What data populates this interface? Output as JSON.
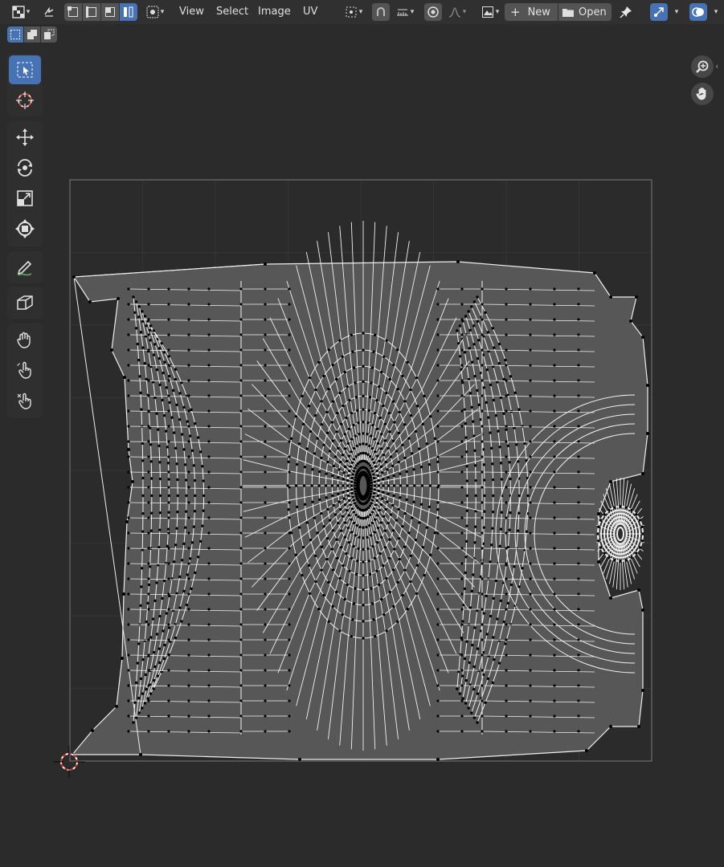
{
  "header": {
    "menus": [
      {
        "id": "view",
        "label": "View"
      },
      {
        "id": "select",
        "label": "Select"
      },
      {
        "id": "image",
        "label": "Image"
      },
      {
        "id": "uv",
        "label": "UV"
      }
    ],
    "new_label": "New",
    "open_label": "Open"
  },
  "icons": {
    "editor_type": "uv-editor-icon",
    "sync_selection": "sync-selection-icon",
    "select_modes": [
      "vertex-select-icon",
      "edge-select-icon",
      "face-select-icon",
      "island-select-icon"
    ],
    "sticky_mode": "sticky-selection-icon",
    "pivot": "pivot-point-icon",
    "snap": "snap-icon",
    "snap_increment": "snap-increment-icon",
    "proportional": "proportional-edit-icon",
    "falloff": "falloff-curve-icon",
    "browse_image": "image-browse-icon",
    "pin": "pin-icon",
    "gizmo": "gizmo-icon",
    "overlay": "overlay-icon",
    "zoom": "zoom-icon",
    "pan": "hand-pan-icon",
    "box_modes": [
      "box-new-icon",
      "box-extend-icon",
      "box-subtract-icon"
    ],
    "tools": [
      "select-box-icon",
      "cursor-icon",
      "move-icon",
      "rotate-icon",
      "scale-icon",
      "transform-icon",
      "annotate-icon",
      "rip-region-icon",
      "grab-icon",
      "relax-icon",
      "pinch-icon"
    ]
  },
  "colors": {
    "accent": "#4772b3",
    "background": "#2b2b2b",
    "header": "#303030",
    "uv_face": "#575757",
    "uv_edge": "#f2f2f2",
    "uv_vertex": "#000000",
    "cursor_red": "#d42f2f"
  }
}
